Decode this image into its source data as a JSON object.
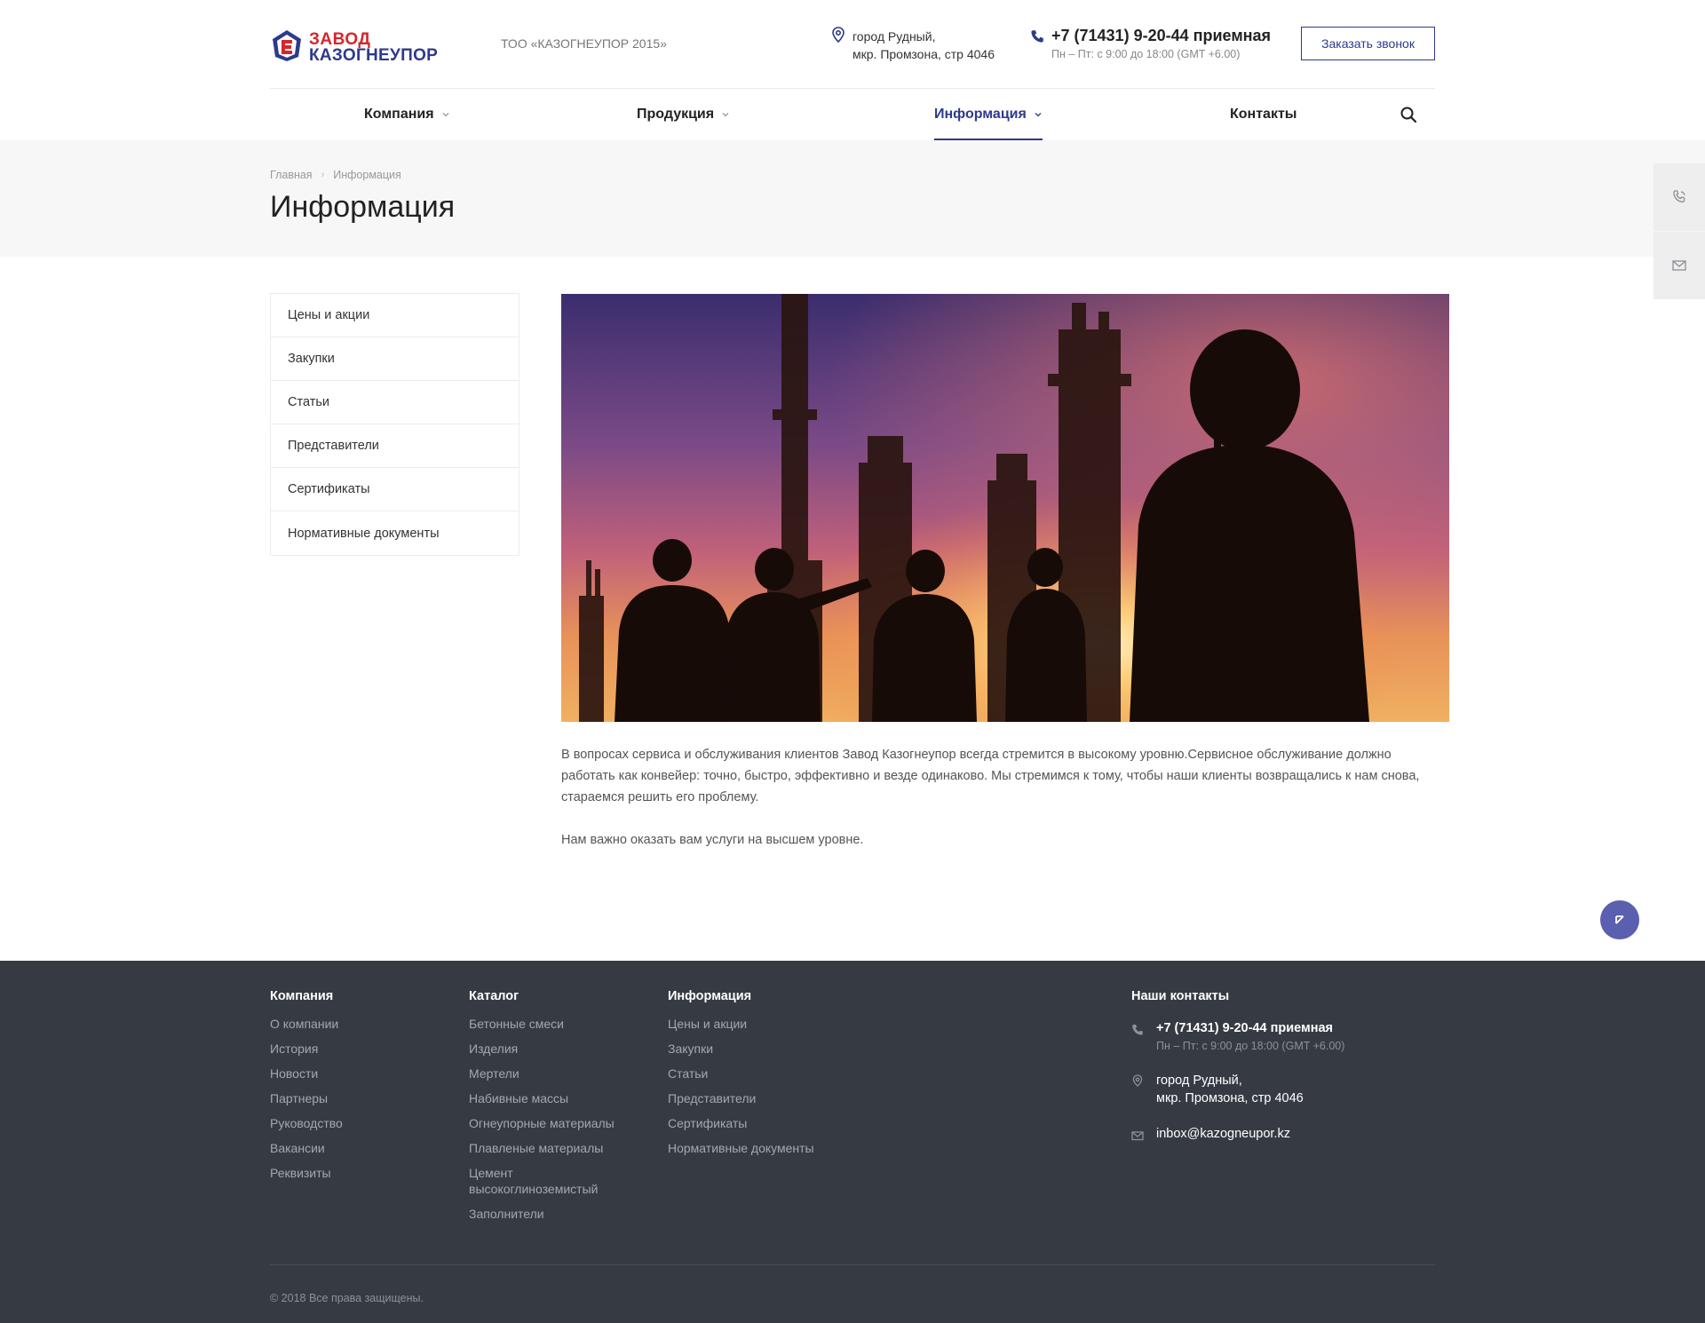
{
  "header": {
    "logo_line1": "ЗАВОД",
    "logo_line2": "КАЗОГНЕУПОР",
    "company_name": "ТОО «КАЗОГНЕУПОР 2015»",
    "address_line1": "город Рудный,",
    "address_line2": "мкр. Промзона, стр 4046",
    "phone": "+7 (71431) 9-20-44 приемная",
    "hours": "Пн – Пт: с 9:00 до 18:00 (GMT +6.00)",
    "callback_label": "Заказать звонок",
    "brand_color": "#2d3a8c",
    "logo_red": "#d6262b"
  },
  "nav": {
    "items": [
      {
        "label": "Компания",
        "has_dropdown": true,
        "active": false
      },
      {
        "label": "Продукция",
        "has_dropdown": true,
        "active": false
      },
      {
        "label": "Информация",
        "has_dropdown": true,
        "active": true
      },
      {
        "label": "Контакты",
        "has_dropdown": false,
        "active": false
      }
    ],
    "search_icon": "search-icon"
  },
  "breadcrumb": {
    "home": "Главная",
    "current": "Информация"
  },
  "page_title": "Информация",
  "side_widget": {
    "icons": [
      "phone-icon",
      "mail-icon"
    ]
  },
  "sidebar": {
    "items": [
      "Цены и акции",
      "Закупки",
      "Статьи",
      "Представители",
      "Сертификаты",
      "Нормативные документы"
    ]
  },
  "content": {
    "paragraph1": "В вопросах сервиса и обслуживания клиентов Завод Казогнеупор  всегда стремится в высокому уровню.Сервисное обслуживание должно работать как конвейер: точно, быстро, эффективно и везде одинаково. Мы стремимся к тому, чтобы наши клиенты возвращались к нам снова, стараемся решить его проблему.",
    "paragraph2": "Нам важно оказать вам услуги на высшем уровне."
  },
  "footer": {
    "company": {
      "title": "Компания",
      "links": [
        "О компании",
        "История",
        "Новости",
        "Партнеры",
        "Руководство",
        "Вакансии",
        "Реквизиты"
      ]
    },
    "catalog": {
      "title": "Каталог",
      "links": [
        "Бетонные смеси",
        "Изделия",
        "Мертели",
        "Набивные массы",
        "Огнеупорные материалы",
        "Плавленые материалы",
        "Цемент высокоглиноземистый",
        "Заполнители"
      ]
    },
    "info": {
      "title": "Информация",
      "links": [
        "Цены и акции",
        "Закупки",
        "Статьи",
        "Представители",
        "Сертификаты",
        "Нормативные документы"
      ]
    },
    "contacts": {
      "title": "Наши контакты",
      "phone": "+7 (71431) 9-20-44 приемная",
      "hours": "Пн – Пт: с 9:00 до 18:00 (GMT +6.00)",
      "address_line1": "город Рудный,",
      "address_line2": "мкр. Промзона, стр 4046",
      "email": "inbox@kazogneupor.kz"
    },
    "copyright": "© 2018 Все права защищены.",
    "background": "#363b43"
  }
}
